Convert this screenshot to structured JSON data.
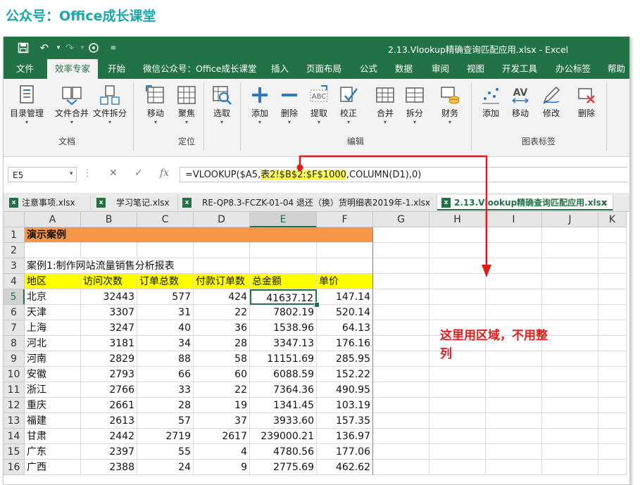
{
  "header": {
    "title": "公众号：Office成长课堂"
  },
  "window": {
    "title": "2.13.Vlookup精确查询匹配应用.xlsx  -  Excel"
  },
  "quick_access": [
    "save-icon",
    "undo-icon",
    "redo-icon",
    "touch-mode-icon",
    "customize-icon"
  ],
  "menu": {
    "items": [
      "文件",
      "效率专家",
      "开始",
      "微信公众号：Office成长课堂",
      "插入",
      "页面布局",
      "公式",
      "数据",
      "审阅",
      "视图",
      "开发工具",
      "办公标签",
      "帮助"
    ],
    "active_index": 1
  },
  "ribbon": {
    "groups": [
      {
        "label": "文档",
        "buttons": [
          "目录管理",
          "文件合并",
          "文件拆分"
        ]
      },
      {
        "label": "定位",
        "buttons": [
          "移动",
          "聚焦"
        ]
      },
      {
        "label": "",
        "buttons": [
          "选取"
        ]
      },
      {
        "label": "编辑",
        "buttons": [
          "添加",
          "删除",
          "提取",
          "校正",
          "合并",
          "拆分",
          "财务"
        ]
      },
      {
        "label": "图表标签",
        "buttons": [
          "添加",
          "移动",
          "修改",
          "删除"
        ]
      }
    ]
  },
  "formula_bar": {
    "name_box": "E5",
    "formula_before": "=VLOOKUP($A5,",
    "formula_highlight": "表2!$B$2:$F$1000",
    "formula_after": ",COLUMN(D1),0)"
  },
  "file_tabs": [
    {
      "label": "注意事项.xlsx",
      "active": false
    },
    {
      "label": "学习笔记.xlsx",
      "active": false
    },
    {
      "label": "RE-QP8.3-FCZK-01-04 退还（换）货明细表2019年-1.xlsx",
      "active": false
    },
    {
      "label": "2.13.Vlookup精确查询匹配应用.xlsx",
      "active": true,
      "close": "×"
    }
  ],
  "sheet": {
    "columns": [
      "A",
      "B",
      "C",
      "D",
      "E",
      "F",
      "G",
      "H",
      "I",
      "J",
      "K"
    ],
    "row_numbers": [
      "1",
      "2",
      "3",
      "4",
      "5",
      "6",
      "7",
      "8",
      "9",
      "10",
      "11",
      "12",
      "13",
      "14",
      "15",
      "16"
    ],
    "selected_cell": "E5",
    "title": "演示案例",
    "case_title": "案例1:制作网站流量销售分析报表",
    "headers": [
      "地区",
      "访问次数",
      "订单总数",
      "付款订单数",
      "总金额",
      "单价"
    ],
    "rows": [
      [
        "北京",
        "32443",
        "577",
        "424",
        "41637.12",
        "147.14"
      ],
      [
        "天津",
        "3307",
        "31",
        "22",
        "7802.19",
        "520.14"
      ],
      [
        "上海",
        "3247",
        "40",
        "36",
        "1538.96",
        "64.13"
      ],
      [
        "河北",
        "3181",
        "34",
        "28",
        "3347.13",
        "176.16"
      ],
      [
        "河南",
        "2829",
        "88",
        "58",
        "11151.69",
        "285.95"
      ],
      [
        "安徽",
        "2793",
        "66",
        "60",
        "6088.59",
        "152.22"
      ],
      [
        "浙江",
        "2766",
        "33",
        "22",
        "7364.36",
        "490.95"
      ],
      [
        "重庆",
        "2661",
        "28",
        "19",
        "1341.45",
        "103.19"
      ],
      [
        "福建",
        "2613",
        "57",
        "37",
        "3933.60",
        "157.35"
      ],
      [
        "甘肃",
        "2442",
        "2719",
        "2617",
        "239000.21",
        "136.97"
      ],
      [
        "广东",
        "2397",
        "55",
        "4",
        "4780.56",
        "177.06"
      ],
      [
        "广西",
        "2388",
        "24",
        "9",
        "2775.69",
        "462.62"
      ]
    ],
    "colors": {
      "title_fill": "#f79646",
      "header_fill": "#ffff00",
      "accent": "#217346"
    }
  },
  "annotation": {
    "text": "这里用区域，不用整列",
    "color": "#e21b1b"
  }
}
